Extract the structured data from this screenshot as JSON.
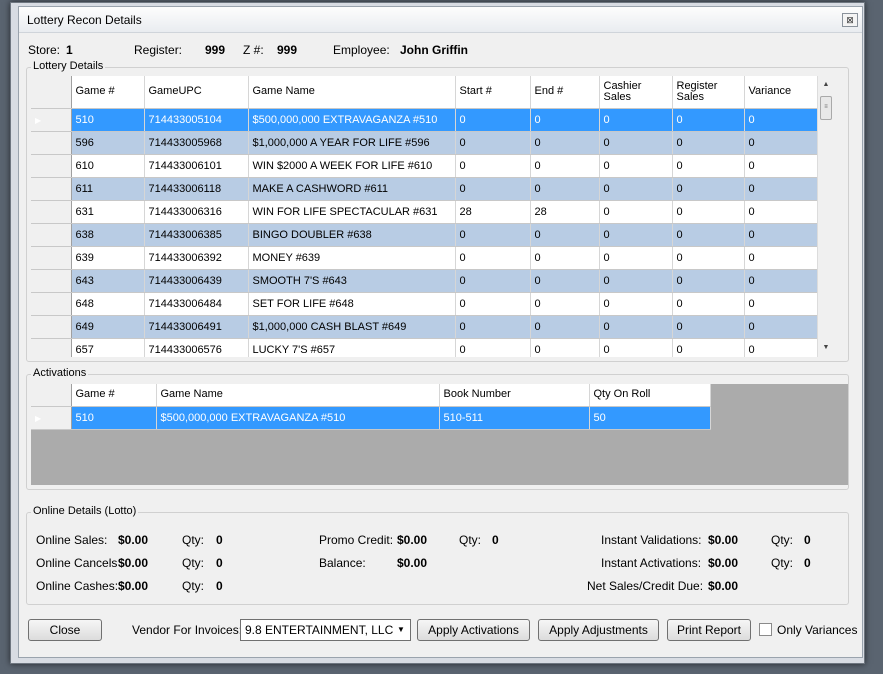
{
  "window": {
    "title": "Lottery Recon Details",
    "close_glyph": "⊠"
  },
  "info": {
    "store_label": "Store:",
    "store": "1",
    "register_label": "Register:",
    "register": "999",
    "z_label": "Z #:",
    "z": "999",
    "employee_label": "Employee:",
    "employee": "John Griffin"
  },
  "lottery": {
    "group_label": "Lottery Details",
    "columns": [
      "Game #",
      "GameUPC",
      "Game Name",
      "Start #",
      "End #",
      "Cashier Sales",
      "Register Sales",
      "Variance"
    ],
    "rows": [
      [
        "510",
        "714433005104",
        "$500,000,000 EXTRAVAGANZA #510",
        "0",
        "0",
        "0",
        "0",
        "0"
      ],
      [
        "596",
        "714433005968",
        "$1,000,000 A YEAR FOR LIFE #596",
        "0",
        "0",
        "0",
        "0",
        "0"
      ],
      [
        "610",
        "714433006101",
        "WIN $2000 A WEEK FOR LIFE #610",
        "0",
        "0",
        "0",
        "0",
        "0"
      ],
      [
        "611",
        "714433006118",
        "MAKE A CASHWORD #611",
        "0",
        "0",
        "0",
        "0",
        "0"
      ],
      [
        "631",
        "714433006316",
        "WIN FOR LIFE SPECTACULAR #631",
        "28",
        "28",
        "0",
        "0",
        "0"
      ],
      [
        "638",
        "714433006385",
        "BINGO DOUBLER #638",
        "0",
        "0",
        "0",
        "0",
        "0"
      ],
      [
        "639",
        "714433006392",
        "MONEY #639",
        "0",
        "0",
        "0",
        "0",
        "0"
      ],
      [
        "643",
        "714433006439",
        "SMOOTH 7'S #643",
        "0",
        "0",
        "0",
        "0",
        "0"
      ],
      [
        "648",
        "714433006484",
        "SET FOR LIFE #648",
        "0",
        "0",
        "0",
        "0",
        "0"
      ],
      [
        "649",
        "714433006491",
        "$1,000,000 CASH BLAST #649",
        "0",
        "0",
        "0",
        "0",
        "0"
      ],
      [
        "657",
        "714433006576",
        "LUCKY 7'S #657",
        "0",
        "0",
        "0",
        "0",
        "0"
      ]
    ],
    "row_styles": [
      "sel",
      "alt",
      "white",
      "alt",
      "white",
      "alt",
      "white",
      "alt",
      "white",
      "alt",
      "white"
    ]
  },
  "activations": {
    "group_label": "Activations",
    "columns": [
      "Game #",
      "Game Name",
      "Book Number",
      "Qty On Roll"
    ],
    "rows": [
      [
        "510",
        "$500,000,000 EXTRAVAGANZA #510",
        "510-511",
        "50"
      ]
    ]
  },
  "online": {
    "group_label": "Online Details (Lotto)",
    "online_sales_label": "Online Sales:",
    "online_sales": "$0.00",
    "online_sales_qty": "0",
    "online_cancels_label": "Online Cancels",
    "online_cancels": "$0.00",
    "online_cancels_qty": "0",
    "online_cashes_label": "Online Cashes:",
    "online_cashes": "$0.00",
    "online_cashes_qty": "0",
    "qty_label": "Qty:",
    "promo_credit_label": "Promo Credit:",
    "promo_credit": "$0.00",
    "promo_credit_qty": "0",
    "balance_label": "Balance:",
    "balance": "$0.00",
    "instant_validations_label": "Instant Validations:",
    "instant_validations": "$0.00",
    "instant_validations_qty": "0",
    "instant_activations_label": "Instant Activations:",
    "instant_activations": "$0.00",
    "instant_activations_qty": "0",
    "net_sales_label": "Net Sales/Credit Due:",
    "net_sales": "$0.00"
  },
  "footer": {
    "close_label": "Close",
    "vendor_label": "Vendor For Invoices:",
    "vendor_value": "9.8 ENTERTAINMENT,  LLC",
    "apply_activations_label": "Apply Activations",
    "apply_adjustments_label": "Apply Adjustments",
    "print_report_label": "Print Report",
    "only_variances_label": "Only Variances",
    "only_variances_checked": false
  },
  "colors": {
    "selection": "#3399ff",
    "alt_row": "#b8cce4",
    "grid_empty": "#ababab"
  }
}
